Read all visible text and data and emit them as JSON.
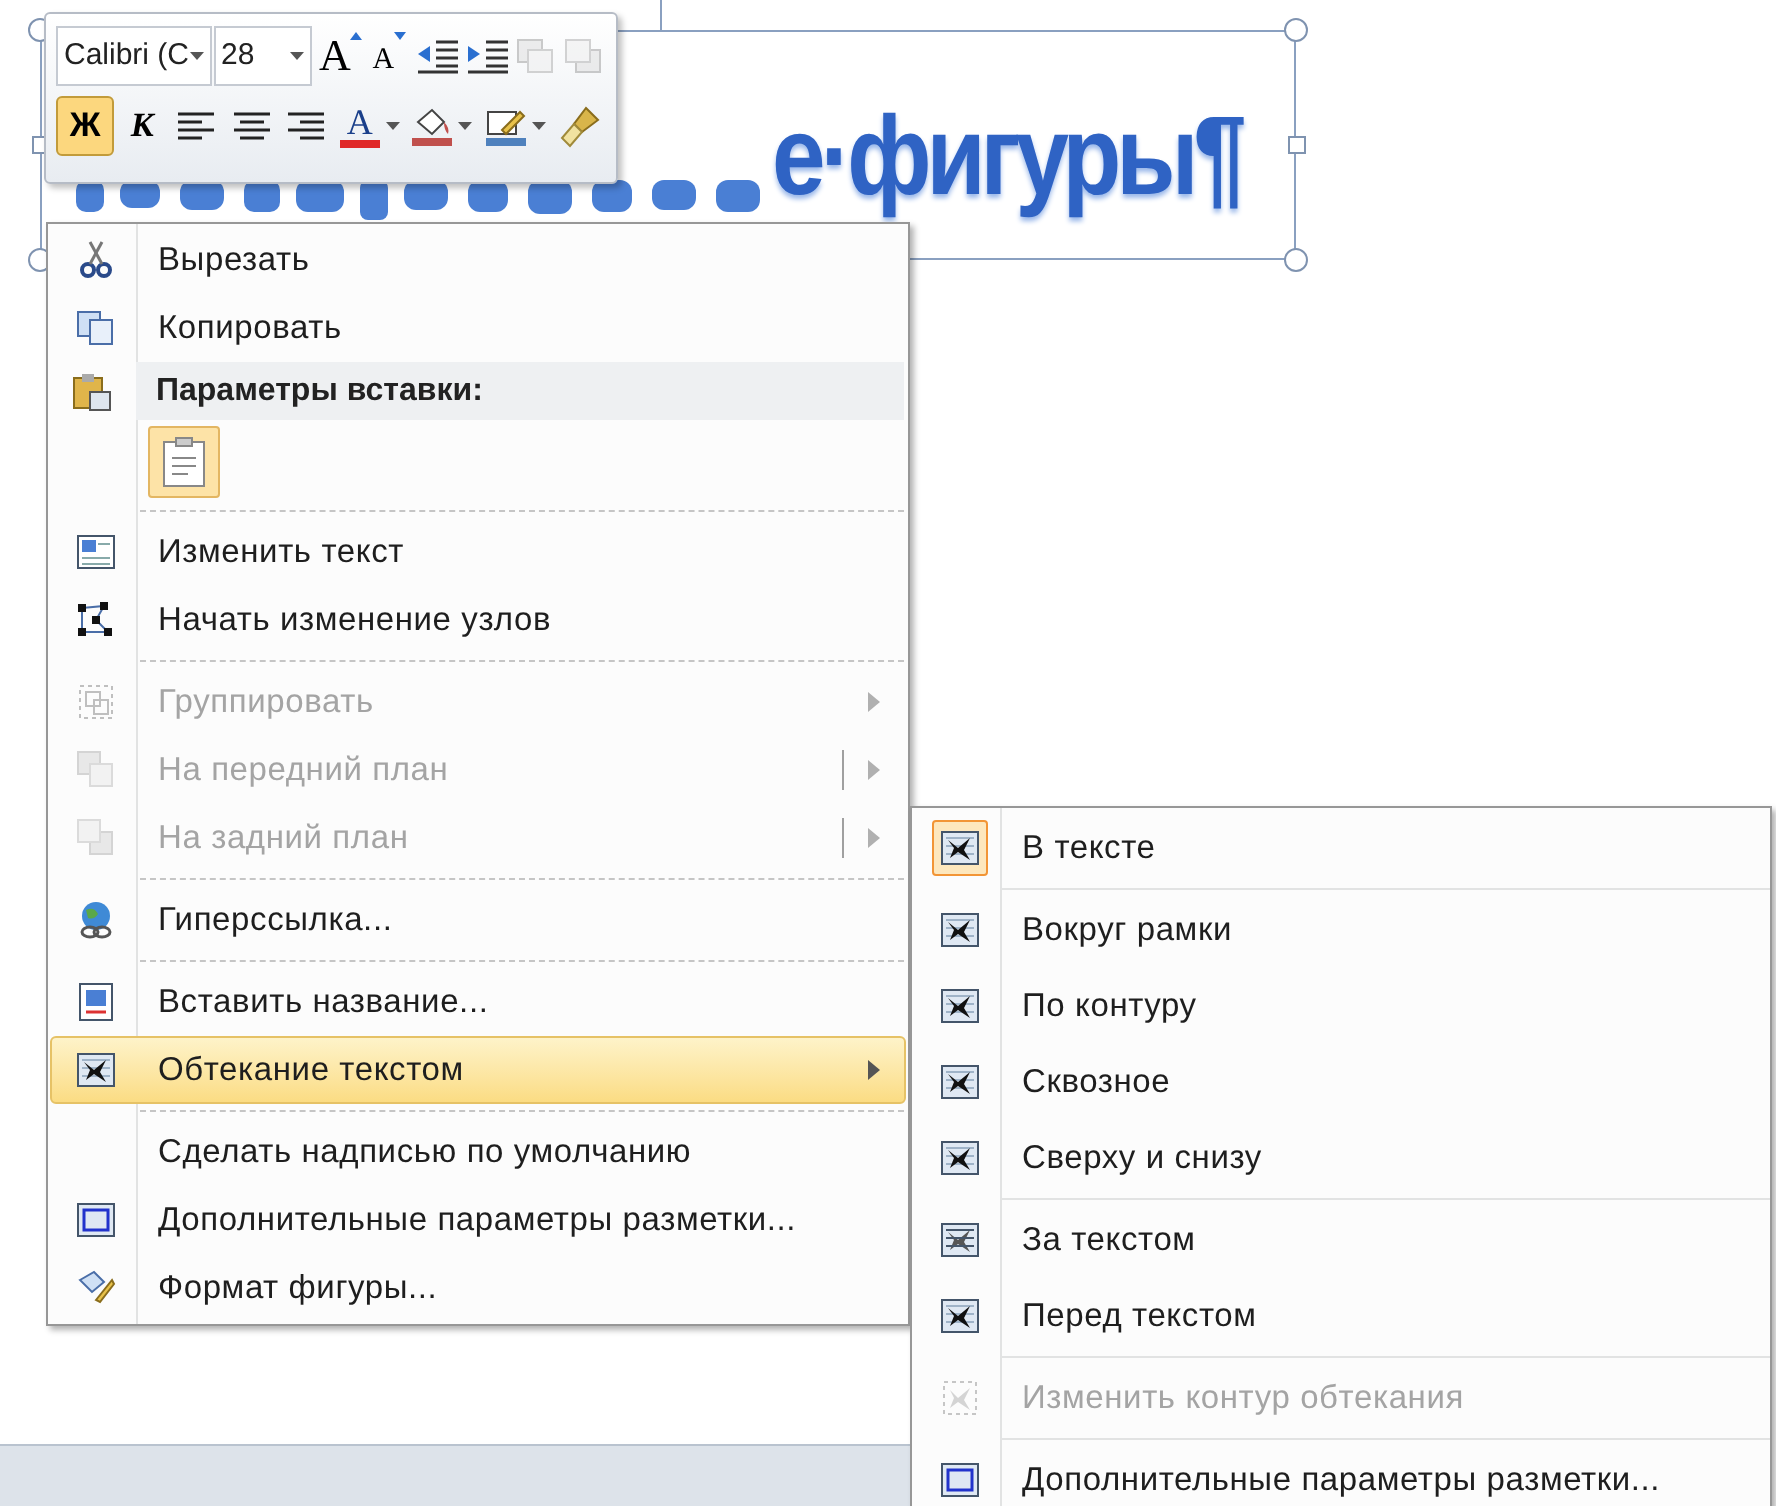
{
  "shape": {
    "visible_text": "е·фигуры¶"
  },
  "mini_toolbar": {
    "font": "Calibri (С",
    "size": "28",
    "row1": [
      {
        "kind": "grow_font",
        "glyph": "A",
        "disabled": false
      },
      {
        "kind": "shrink_font",
        "glyph": "A",
        "disabled": false
      },
      {
        "kind": "decrease_indent",
        "disabled": false
      },
      {
        "kind": "increase_indent",
        "disabled": false
      },
      {
        "kind": "bring_forward",
        "disabled": true
      },
      {
        "kind": "send_backward",
        "disabled": true
      }
    ],
    "row2": [
      {
        "kind": "bold",
        "glyph": "Ж",
        "selected": true
      },
      {
        "kind": "italic",
        "glyph": "К",
        "selected": false
      },
      {
        "kind": "align_left",
        "selected": false
      },
      {
        "kind": "align_center",
        "selected": false
      },
      {
        "kind": "align_right",
        "selected": false
      },
      {
        "kind": "font_color",
        "glyph": "A",
        "color": "#e02828"
      },
      {
        "kind": "fill_color",
        "color": "#c0504d"
      },
      {
        "kind": "line_color",
        "color": "#4f81bd"
      },
      {
        "kind": "format_painter"
      }
    ]
  },
  "context_menu": [
    {
      "kind": "item",
      "label": "Вырезать",
      "disabled": false,
      "selected": false,
      "submenu": false,
      "split": false
    },
    {
      "kind": "item",
      "label": "Копировать",
      "disabled": false,
      "selected": false,
      "submenu": false,
      "split": false
    },
    {
      "kind": "header",
      "label": "Параметры вставки:"
    },
    {
      "kind": "paste_options"
    },
    {
      "kind": "separator"
    },
    {
      "kind": "item",
      "label": "Изменить текст",
      "disabled": false,
      "selected": false,
      "submenu": false,
      "split": false
    },
    {
      "kind": "item",
      "label": "Начать изменение узлов",
      "disabled": false,
      "selected": false,
      "submenu": false,
      "split": false
    },
    {
      "kind": "separator"
    },
    {
      "kind": "item",
      "label": "Группировать",
      "disabled": true,
      "selected": false,
      "submenu": true,
      "split": false
    },
    {
      "kind": "item",
      "label": "На передний план",
      "disabled": true,
      "selected": false,
      "submenu": true,
      "split": true
    },
    {
      "kind": "item",
      "label": "На задний план",
      "disabled": true,
      "selected": false,
      "submenu": true,
      "split": true
    },
    {
      "kind": "separator"
    },
    {
      "kind": "item",
      "label": "Гиперссылка...",
      "disabled": false,
      "selected": false,
      "submenu": false,
      "split": false
    },
    {
      "kind": "separator"
    },
    {
      "kind": "item",
      "label": "Вставить название...",
      "disabled": false,
      "selected": false,
      "submenu": false,
      "split": false
    },
    {
      "kind": "item",
      "label": "Обтекание текстом",
      "disabled": false,
      "selected": true,
      "submenu": true,
      "split": false
    },
    {
      "kind": "separator"
    },
    {
      "kind": "item",
      "label": "Сделать надписью по умолчанию",
      "disabled": false,
      "selected": false,
      "submenu": false,
      "split": false
    },
    {
      "kind": "item",
      "label": "Дополнительные параметры разметки...",
      "disabled": false,
      "selected": false,
      "submenu": false,
      "split": false
    },
    {
      "kind": "item",
      "label": "Формат фигуры...",
      "disabled": false,
      "selected": false,
      "submenu": false,
      "split": false
    }
  ],
  "wrap_submenu": [
    {
      "kind": "item",
      "label": "В тексте",
      "disabled": false,
      "selected": true
    },
    {
      "kind": "separator"
    },
    {
      "kind": "item",
      "label": "Вокруг рамки",
      "disabled": false,
      "selected": false
    },
    {
      "kind": "item",
      "label": "По контуру",
      "disabled": false,
      "selected": false
    },
    {
      "kind": "item",
      "label": "Сквозное",
      "disabled": false,
      "selected": false
    },
    {
      "kind": "item",
      "label": "Сверху и снизу",
      "disabled": false,
      "selected": false
    },
    {
      "kind": "separator"
    },
    {
      "kind": "item",
      "label": "За текстом",
      "disabled": false,
      "selected": false
    },
    {
      "kind": "item",
      "label": "Перед текстом",
      "disabled": false,
      "selected": false
    },
    {
      "kind": "separator"
    },
    {
      "kind": "item",
      "label": "Изменить контур обтекания",
      "disabled": true,
      "selected": false
    },
    {
      "kind": "separator"
    },
    {
      "kind": "item",
      "label": "Дополнительные параметры разметки...",
      "disabled": false,
      "selected": false
    }
  ]
}
